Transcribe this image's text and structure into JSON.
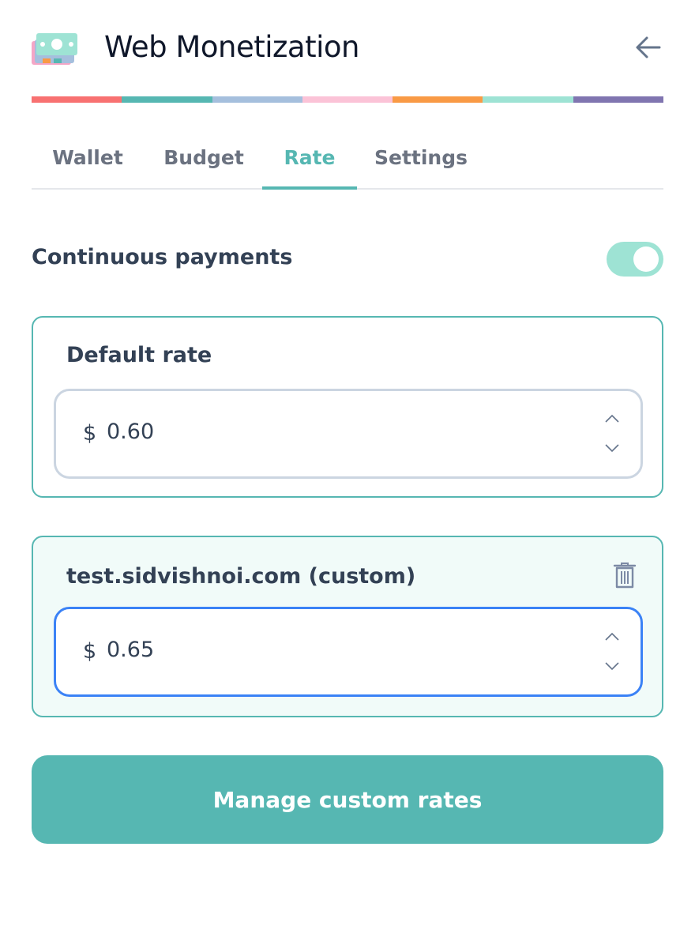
{
  "app": {
    "title": "Web Monetization",
    "logo_icon": "money-bill-icon",
    "back_icon": "arrow-left-icon"
  },
  "stripe_colors": [
    "#f87171",
    "#56b7b2",
    "#a5bfdd",
    "#fbc3d7",
    "#f99a45",
    "#9ee3d4",
    "#8075b0"
  ],
  "tabs": [
    {
      "label": "Wallet",
      "active": false
    },
    {
      "label": "Budget",
      "active": false
    },
    {
      "label": "Rate",
      "active": true
    },
    {
      "label": "Settings",
      "active": false
    }
  ],
  "continuous_payments": {
    "label": "Continuous payments",
    "enabled": true
  },
  "default_rate": {
    "title": "Default rate",
    "currency": "$",
    "value": "0.60"
  },
  "custom_rate": {
    "title": "test.sidvishnoi.com (custom)",
    "currency": "$",
    "value": "0.65",
    "delete_icon": "trash-icon"
  },
  "manage_button": {
    "label": "Manage custom rates"
  },
  "colors": {
    "accent": "#56b7b2",
    "toggle_on": "#9ee3d4",
    "focus": "#3b82f6"
  }
}
